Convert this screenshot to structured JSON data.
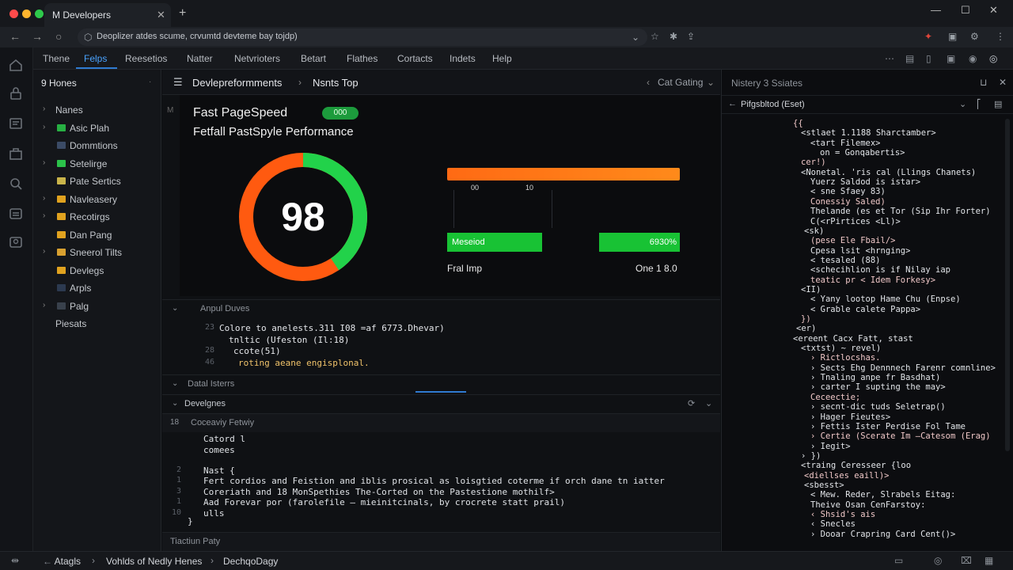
{
  "window": {
    "tab_title": "M Developers",
    "new_tab_glyph": "+",
    "close_glyph": "✕",
    "controls": [
      "—",
      "☐",
      "✕"
    ]
  },
  "address": {
    "url": "Deoplizer atdes scume, crvumtd devteme bay tojdp)"
  },
  "menu": {
    "items": [
      "Thene",
      "Felps",
      "Reesetios",
      "Natter",
      "Netvrioters",
      "Betart",
      "Flathes",
      "Cortacts",
      "Indets",
      "Help"
    ],
    "active_index": 1
  },
  "sidebar": {
    "header": "9 Hones",
    "items": [
      {
        "label": "Nanes",
        "chevron": "›",
        "folder_color": ""
      },
      {
        "label": "Asic Plah",
        "chevron": "›",
        "folder_color": "#27b043"
      },
      {
        "label": "Dommtions",
        "chevron": "",
        "folder_color": "#3b4b66"
      },
      {
        "label": "Setelirge",
        "chevron": "›",
        "folder_color": "#2bc24a"
      },
      {
        "label": "Pate Sertics",
        "chevron": "",
        "folder_color": "#c9b44a"
      },
      {
        "label": "Navleasery",
        "chevron": "›",
        "folder_color": "#e0a21f"
      },
      {
        "label": "Recotirgs",
        "chevron": "›",
        "folder_color": "#e0a21f"
      },
      {
        "label": "Dan Pang",
        "chevron": "",
        "folder_color": "#e0a21f"
      },
      {
        "label": "Sneerol Tilts",
        "chevron": "›",
        "folder_color": "#d8a030"
      },
      {
        "label": "Devlegs",
        "chevron": "",
        "folder_color": "#e0a21f"
      },
      {
        "label": "Arpls",
        "chevron": "",
        "folder_color": "#2c3a50"
      },
      {
        "label": "Palg",
        "chevron": "›",
        "folder_color": "#39414c"
      },
      {
        "label": "Piesats",
        "chevron": "",
        "folder_color": ""
      }
    ]
  },
  "editor": {
    "breadcrumb": [
      "Devlepreformments",
      "Nsnts Top"
    ],
    "right_label": "Cat Gating",
    "gutter_mark": "M",
    "perf": {
      "title": "Fast PageSpeed",
      "badge": "000",
      "subtitle": "Fetfall PastSpyle Performance",
      "score": "98",
      "score_fraction": 0.98,
      "tick_a": "00",
      "tick_b": "10",
      "box_left_label": "Meseiod",
      "box_right_label": "6930%",
      "bottom_left": "Fral Imp",
      "bottom_right": "One 1 8.0"
    },
    "section1": {
      "label": "Anpul Duves",
      "lines": [
        {
          "num": "23",
          "text": "Colore to anelests.311 I08 =af 6773.Dhevar)"
        },
        {
          "num": "",
          "text": "tnltic (Ufeston (Il:18)"
        },
        {
          "num": "28",
          "text": "ccote(51)"
        },
        {
          "num": "46",
          "text": "roting aeane engisplonal."
        }
      ]
    },
    "section2": {
      "label": "Datal Isterrs"
    },
    "section3": {
      "label": "Develgnes"
    },
    "section4": {
      "label": "Coceaviy Fetwiy",
      "num": "18",
      "lines": [
        {
          "num": "",
          "text": "Catord l"
        },
        {
          "num": "",
          "text": "comees"
        },
        {
          "num": "2",
          "text": "Nast {"
        },
        {
          "num": "1",
          "text": "Fert cordios and Feistion and iblis prosical as loisgtied coterme if orch dane tn iatter"
        },
        {
          "num": "3",
          "text": "Coreriath and 18 MonSpethies The-Corted on the Pastestione mothilf>"
        },
        {
          "num": "1",
          "text": "Aad Forevar por (farolefile — mieinitcinals, by crocrete statt prail)"
        },
        {
          "num": "10",
          "text": "ulls"
        },
        {
          "num": "",
          "text": "}"
        }
      ]
    },
    "footer_tab": "Tiactiun Paty"
  },
  "right_panel": {
    "header": "Nistery 3 Ssiates",
    "sub": "Pifgsbltod (Eset)",
    "lines": [
      "{{",
      "<stlaet 1.1188 Sharctamber>",
      "<tart Filemex>",
      "on = Gonqabertis>",
      "cer!)",
      "<Nonetal. 'ris cal (Llings Chanets)",
      "Yuerz Saldod is istar>",
      "< sne Sfaey 83)",
      "Conessiy Saled)",
      "Thelande (es et Tor (Sip Ihr Forter)",
      "C(<rPirtices <Ll)>",
      "<sk)",
      "(pese Ele Fbail/>",
      "Cpesa lsit <hrnging>",
      "< tesaled (88)",
      "<schecihlion is if Nilay iap",
      "teatic pr < Idem Forkesy>",
      "<II)",
      "< Yany lootop Hame Chu (Enpse)",
      "< Grable calete Pappa>",
      "})",
      "<er)",
      "<ereent Cacx Fatt, stast",
      "<txtst)          ~ revel)",
      "› Rictlocshas.",
      "› Sects Ehg Dennnech Farenr comnline>",
      "› Tnaling anpe fr Basdhat)",
      "› carter I supting the may>",
      "Ceceectie;",
      "› secnt-dic tuds Seletrap()",
      "› Hager  Fieutes>",
      "› Fettis Ister Perdise Fol Tame",
      "› Certie (Scerate Im —Catesom (Erag)",
      "› Iegit>",
      "› })",
      "<traing Ceresseer {loo",
      "<diellses eaill)>",
      "<sbesst>",
      "< Mew. Reder, Slrabels Eitag:",
      "Theive Osan CenFarstoy:",
      "‹ Shsid's ais",
      "‹ Snecles",
      "› Dooar Crapring Card Cent()>"
    ]
  },
  "status": {
    "items": [
      "Atagls",
      "Vohlds of Nedly Henes",
      "DechqoDagy"
    ]
  },
  "colors": {
    "accent_blue": "#2f7bd1",
    "gauge_green": "#22d24a",
    "gauge_orange": "#ff5a10",
    "box_green": "#18c234",
    "bar_orange": "#ff7a16"
  },
  "icons": [
    "search-icon",
    "files-icon",
    "extensions-icon",
    "settings-icon",
    "folder-icon",
    "chevron-right-icon",
    "close-icon",
    "refresh-icon",
    "star-icon",
    "profile-icon"
  ]
}
